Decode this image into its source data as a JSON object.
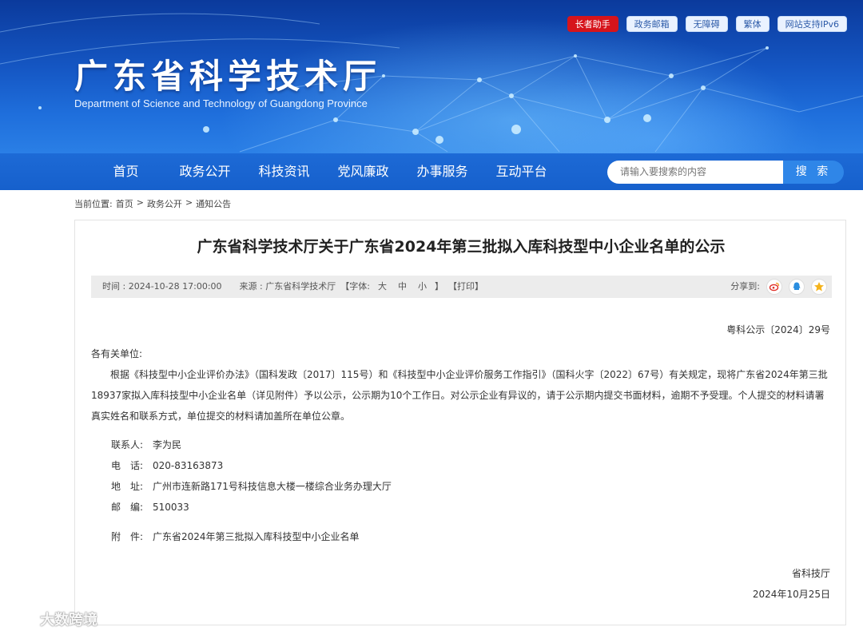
{
  "header": {
    "top_buttons": [
      "长者助手",
      "政务邮箱",
      "无障碍",
      "繁体",
      "网站支持IPv6"
    ],
    "title": "广东省科学技术厅",
    "subtitle": "Department of Science and Technology of Guangdong Province"
  },
  "nav": {
    "items": [
      "首页",
      "政务公开",
      "科技资讯",
      "党风廉政",
      "办事服务",
      "互动平台"
    ],
    "search_placeholder": "请输入要搜索的内容",
    "search_button": "搜 索"
  },
  "breadcrumb": {
    "prefix": "当前位置:",
    "items": [
      "首页",
      ">",
      "政务公开",
      ">",
      "通知公告"
    ]
  },
  "article": {
    "title": "广东省科学技术厅关于广东省2024年第三批拟入库科技型中小企业名单的公示",
    "meta": {
      "time": "时间 : 2024-10-28 17:00:00",
      "source": "来源 : 广东省科学技术厅",
      "font_label": "【字体:",
      "sizes": [
        "大",
        "中",
        "小"
      ],
      "font_close": "】",
      "print": "【打印】",
      "share_label": "分享到:"
    },
    "doc_no": "粤科公示〔2024〕29号",
    "salutation": "各有关单位:",
    "paragraph": "根据《科技型中小企业评价办法》（国科发政〔2017〕115号）和《科技型中小企业评价服务工作指引》（国科火字〔2022〕67号）有关规定，现将广东省2024年第三批18937家拟入库科技型中小企业名单（详见附件）予以公示，公示期为10个工作日。对公示企业有异议的，请于公示期内提交书面材料，逾期不予受理。个人提交的材料请署真实姓名和联系方式，单位提交的材料请加盖所在单位公章。",
    "contact": [
      {
        "k": "联系人:",
        "v": "李为民"
      },
      {
        "k": "电　话:",
        "v": "020-83163873"
      },
      {
        "k": "地　址:",
        "v": "广州市连新路171号科技信息大楼一楼综合业务办理大厅"
      },
      {
        "k": "邮　编:",
        "v": "510033"
      }
    ],
    "attachment": {
      "k": "附　件:",
      "v": "广东省2024年第三批拟入库科技型中小企业名单"
    },
    "signature": "省科技厅",
    "date": "2024年10月25日"
  },
  "watermark": "大数跨境",
  "colors": {
    "nav_blue": "#1660cc",
    "search_button": "#2f86e8",
    "elder_button": "#d6141b"
  }
}
